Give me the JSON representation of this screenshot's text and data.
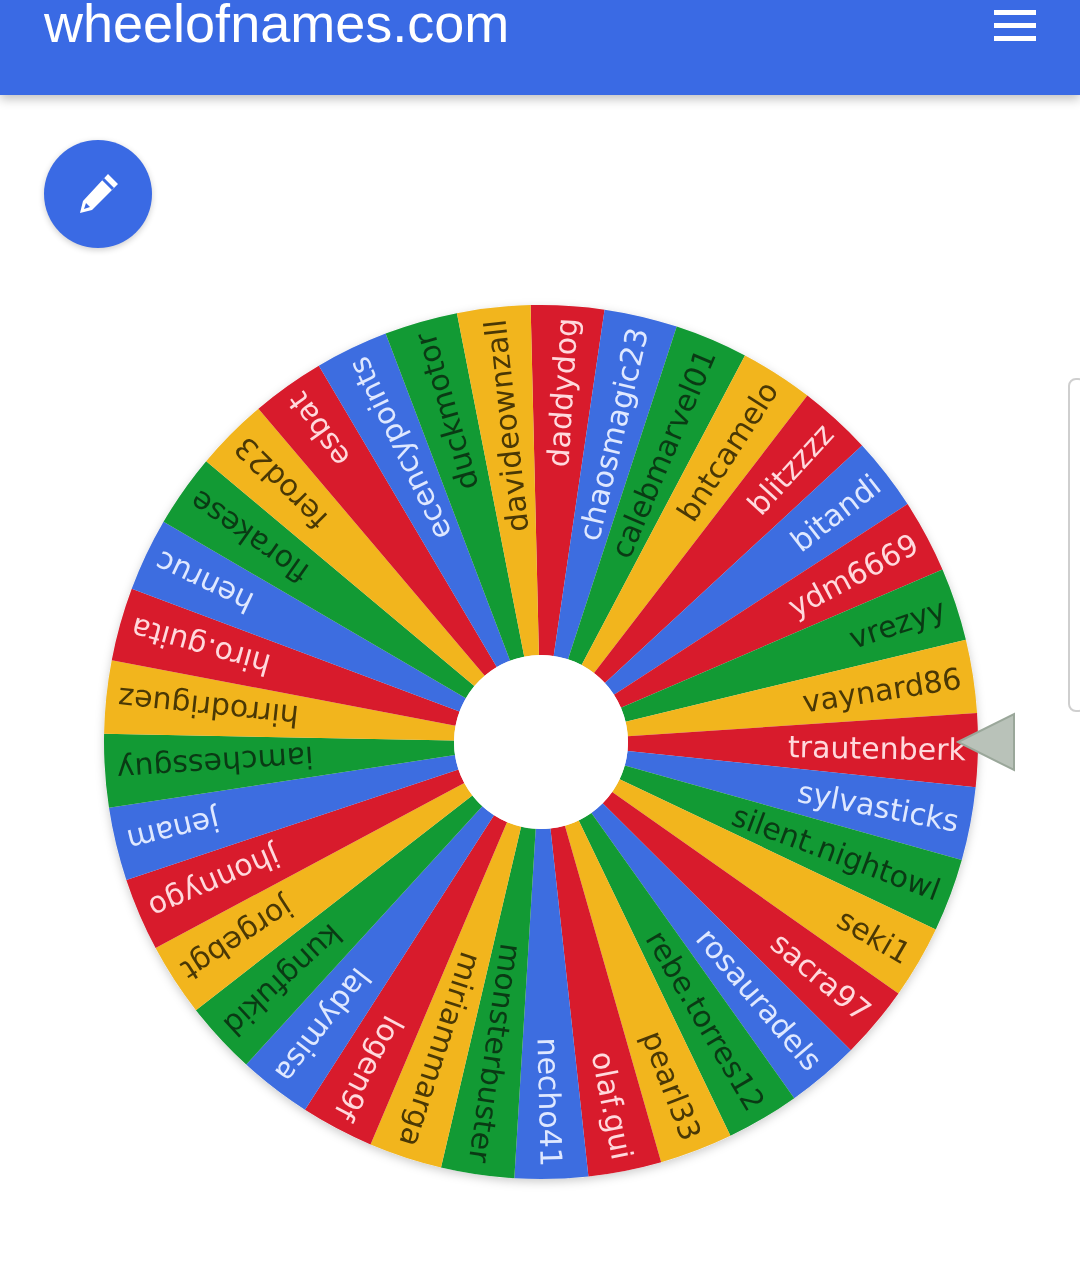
{
  "header": {
    "title": "wheelofnames.com"
  },
  "wheel": {
    "entries": [
      {
        "name": "daddydog",
        "color": "#d81b2c"
      },
      {
        "name": "chaosmagic23",
        "color": "#3d6de0"
      },
      {
        "name": "calebmarvel01",
        "color": "#129a34"
      },
      {
        "name": "bntcamelo",
        "color": "#f2b51d"
      },
      {
        "name": "blitzzzz",
        "color": "#d81b2c"
      },
      {
        "name": "bitandi",
        "color": "#3d6de0"
      },
      {
        "name": "ydm6669",
        "color": "#d81b2c"
      },
      {
        "name": "vrezyy",
        "color": "#129a34"
      },
      {
        "name": "vaynard86",
        "color": "#f2b51d"
      },
      {
        "name": "trautenberk",
        "color": "#d81b2c"
      },
      {
        "name": "sylvasticks",
        "color": "#3d6de0"
      },
      {
        "name": "silent.nightowl",
        "color": "#129a34"
      },
      {
        "name": "seki1",
        "color": "#f2b51d"
      },
      {
        "name": "sacra97",
        "color": "#d81b2c"
      },
      {
        "name": "rosauradels",
        "color": "#3d6de0"
      },
      {
        "name": "rebe.torres12",
        "color": "#129a34"
      },
      {
        "name": "pearl33",
        "color": "#f2b51d"
      },
      {
        "name": "olaf.gui",
        "color": "#d81b2c"
      },
      {
        "name": "necho41",
        "color": "#3d6de0"
      },
      {
        "name": "monsterbuster",
        "color": "#129a34"
      },
      {
        "name": "miriammarga",
        "color": "#f2b51d"
      },
      {
        "name": "logen9f",
        "color": "#d81b2c"
      },
      {
        "name": "ladymisa",
        "color": "#3d6de0"
      },
      {
        "name": "kungfukid",
        "color": "#129a34"
      },
      {
        "name": "jorgebgt",
        "color": "#f2b51d"
      },
      {
        "name": "jhonnygo",
        "color": "#d81b2c"
      },
      {
        "name": "jenam",
        "color": "#3d6de0"
      },
      {
        "name": "iamchessguy",
        "color": "#129a34"
      },
      {
        "name": "hirrodriguez",
        "color": "#f2b51d"
      },
      {
        "name": "hiro.guita",
        "color": "#d81b2c"
      },
      {
        "name": "henruc",
        "color": "#3d6de0"
      },
      {
        "name": "florakese",
        "color": "#129a34"
      },
      {
        "name": "ferod23",
        "color": "#f2b51d"
      },
      {
        "name": "esbat",
        "color": "#d81b2c"
      },
      {
        "name": "ecencypoints",
        "color": "#3d6de0"
      },
      {
        "name": "duckmotor",
        "color": "#129a34"
      },
      {
        "name": "davideownzall",
        "color": "#f2b51d"
      }
    ]
  }
}
